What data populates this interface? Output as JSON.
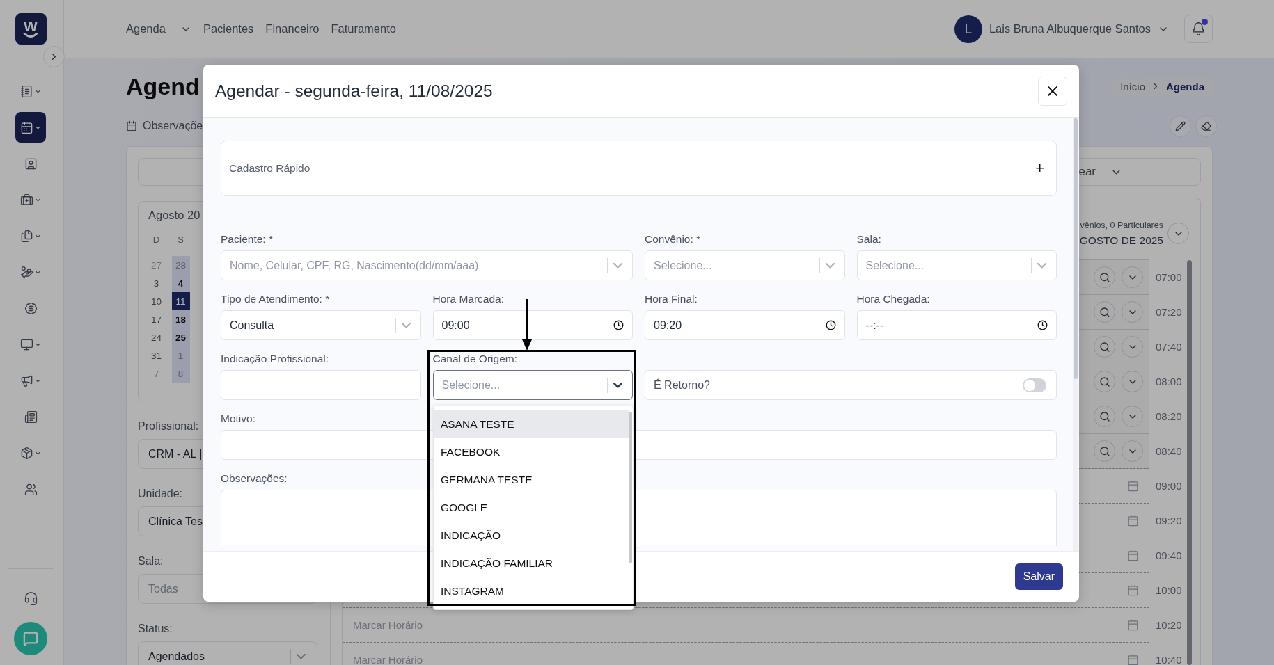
{
  "brand": {
    "letter": "W"
  },
  "sidebar": {
    "items": [
      {
        "selected": false,
        "dropdown": true
      },
      {
        "selected": true,
        "dropdown": true
      },
      {
        "selected": false,
        "dropdown": false
      },
      {
        "selected": false,
        "dropdown": true
      },
      {
        "selected": false,
        "dropdown": true
      },
      {
        "selected": false,
        "dropdown": true
      },
      {
        "selected": false,
        "dropdown": false
      },
      {
        "selected": false,
        "dropdown": true
      },
      {
        "selected": false,
        "dropdown": true
      },
      {
        "selected": false,
        "dropdown": false
      },
      {
        "selected": false,
        "dropdown": true
      },
      {
        "selected": false,
        "dropdown": false
      }
    ]
  },
  "header": {
    "nav": [
      {
        "label": "Agenda",
        "dropdown": true
      },
      {
        "label": "Pacientes",
        "dropdown": false
      },
      {
        "label": "Financeiro",
        "dropdown": false
      },
      {
        "label": "Faturamento",
        "dropdown": false
      }
    ],
    "user": {
      "initial": "L",
      "name": "Lais Bruna Albuquerque Santos"
    },
    "notifications": {
      "unread": true
    }
  },
  "page": {
    "title": "Agend",
    "subtitle": "Observaçõe",
    "breadcrumb": [
      {
        "label": "Início",
        "current": false
      },
      {
        "label": "Agenda",
        "current": true
      }
    ],
    "toolbar": {
      "label": "ear"
    },
    "calendar": {
      "title": "Agosto 20",
      "weekdays": [
        "D",
        "S"
      ],
      "weeks": [
        [
          {
            "day": "27",
            "outside": true,
            "workday": false,
            "selected": false
          },
          {
            "day": "28",
            "outside": true,
            "workday": true,
            "selected": false
          }
        ],
        [
          {
            "day": "3",
            "outside": false,
            "workday": false,
            "selected": false
          },
          {
            "day": "4",
            "outside": false,
            "workday": true,
            "selected": false
          }
        ],
        [
          {
            "day": "10",
            "outside": false,
            "workday": false,
            "selected": false
          },
          {
            "day": "11",
            "outside": false,
            "workday": true,
            "selected": true
          }
        ],
        [
          {
            "day": "17",
            "outside": false,
            "workday": false,
            "selected": false
          },
          {
            "day": "18",
            "outside": false,
            "workday": true,
            "selected": false
          }
        ],
        [
          {
            "day": "24",
            "outside": false,
            "workday": false,
            "selected": false
          },
          {
            "day": "25",
            "outside": false,
            "workday": true,
            "selected": false
          }
        ],
        [
          {
            "day": "31",
            "outside": false,
            "workday": false,
            "selected": false
          },
          {
            "day": "1",
            "outside": true,
            "workday": true,
            "selected": false
          }
        ],
        [
          {
            "day": "7",
            "outside": true,
            "workday": false,
            "selected": false
          },
          {
            "day": "8",
            "outside": true,
            "workday": true,
            "selected": false
          }
        ]
      ]
    },
    "filters": [
      {
        "label": "Profissional:",
        "value": "CRM - AL |"
      },
      {
        "label": "Unidade:",
        "value": "Clínica Tes"
      },
      {
        "label": "Sala:",
        "placeholder": "Todas"
      },
      {
        "label": "Status:",
        "value": "Agendados",
        "dropdown": true
      }
    ],
    "schedule": {
      "summary": "vênios, 0 Particulares",
      "month": "GOSTO DE 2025",
      "rows": [
        {
          "time": "07:00",
          "kind": "booked"
        },
        {
          "time": "07:20",
          "kind": "booked"
        },
        {
          "time": "07:40",
          "kind": "booked"
        },
        {
          "time": "08:00",
          "kind": "booked"
        },
        {
          "time": "08:20",
          "kind": "booked"
        },
        {
          "time": "08:40",
          "kind": "booked"
        },
        {
          "time": "09:00",
          "kind": "free"
        },
        {
          "time": "09:20",
          "kind": "free"
        },
        {
          "time": "09:40",
          "kind": "free"
        },
        {
          "time": "10:00",
          "kind": "free"
        },
        {
          "time": "10:20",
          "kind": "free",
          "label": "Marcar Horário"
        },
        {
          "time": "10:40",
          "kind": "free",
          "label": "Marcar Horário"
        }
      ]
    }
  },
  "modal": {
    "title": "Agendar - segunda-feira, 11/08/2025",
    "quick_register": {
      "label": "Cadastro Rápido",
      "action": "+"
    },
    "form": [
      [
        {
          "kind": "select",
          "label": "Paciente: *",
          "placeholder": "Nome, Celular, CPF, RG, Nascimento(dd/mm/aaa)",
          "focused": false
        },
        {
          "kind": "select",
          "label": "Convênio: *",
          "placeholder": "Selecione...",
          "focused": false
        },
        {
          "kind": "select",
          "label": "Sala:",
          "placeholder": "Selecione...",
          "focused": false
        }
      ],
      [
        {
          "kind": "select",
          "label": "Tipo de Atendimento: *",
          "value": "Consulta",
          "focused": false
        },
        {
          "kind": "time",
          "label": "Hora Marcada:",
          "value": "09:00"
        },
        {
          "kind": "time",
          "label": "Hora Final:",
          "value": "09:20"
        },
        {
          "kind": "time",
          "label": "Hora Chegada:",
          "value": "--:--"
        }
      ],
      [
        {
          "kind": "text",
          "label": "Indicação Profissional:"
        },
        {
          "kind": "select",
          "label": "Canal de Origem:",
          "placeholder": "Selecione...",
          "focused": true,
          "open": true,
          "options": [
            {
              "label": "ASANA TESTE",
              "highlighted": true
            },
            {
              "label": "FACEBOOK",
              "highlighted": false
            },
            {
              "label": "GERMANA TESTE",
              "highlighted": false
            },
            {
              "label": "GOOGLE",
              "highlighted": false
            },
            {
              "label": "INDICAÇÃO",
              "highlighted": false
            },
            {
              "label": "INDICAÇÃO FAMILIAR",
              "highlighted": false
            },
            {
              "label": "INSTAGRAM",
              "highlighted": false
            }
          ]
        },
        {
          "kind": "toggle",
          "label": "É Retorno?",
          "on": false
        }
      ],
      [
        {
          "kind": "text",
          "label": "Motivo:"
        }
      ],
      [
        {
          "kind": "textarea",
          "label": "Observações:"
        }
      ]
    ],
    "save_button": "Salvar",
    "annotations": {
      "outline": true,
      "arrow": true
    }
  }
}
